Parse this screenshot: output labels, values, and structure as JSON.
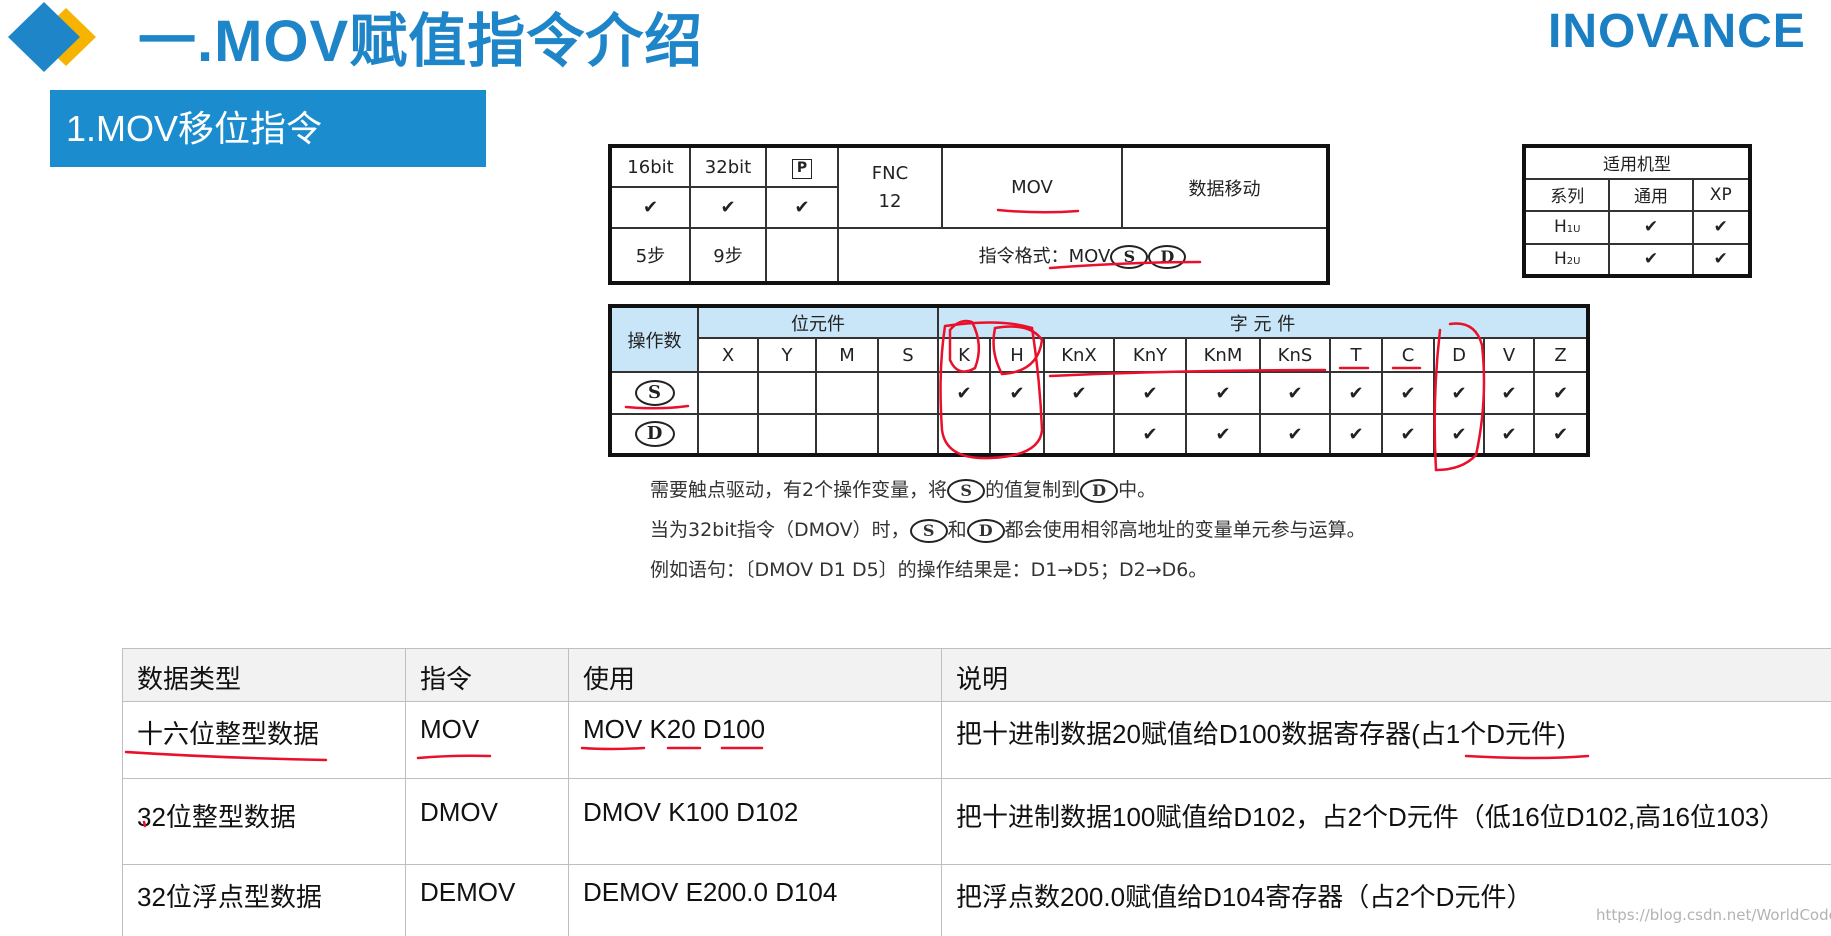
{
  "header": {
    "title": "一.MOV赋值指令介绍",
    "brand": "INOVANCE",
    "logo_icon": "diamond-logo-icon",
    "colors": {
      "brand_blue": "#1e86c8",
      "logo_gold": "#f6b400",
      "section_bg": "#1b8ccd"
    }
  },
  "section": {
    "title": "1.MOV移位指令"
  },
  "instruction_table": {
    "bit16": "16bit",
    "bit32": "32bit",
    "pulse_symbol": "P",
    "check": "✔",
    "fnc_label": "FNC",
    "fnc_no": "12",
    "mnemonic": "MOV",
    "description": "数据移动",
    "steps16": "5步",
    "steps32": "9步",
    "format_label": "指令格式：",
    "format_mnemonic": "MOV",
    "operand_s": "S",
    "operand_d": "D"
  },
  "models_table": {
    "title": "适用机型",
    "headers": [
      "系列",
      "通用",
      "XP"
    ],
    "rows": [
      {
        "name": "H",
        "sub": "1U",
        "general": "✔",
        "xp": "✔"
      },
      {
        "name": "H",
        "sub": "2U",
        "general": "✔",
        "xp": "✔"
      }
    ]
  },
  "operand_table": {
    "operand_label": "操作数",
    "bit_group": "位元件",
    "word_group": "字 元 件",
    "bit_devices": [
      "X",
      "Y",
      "M",
      "S"
    ],
    "word_devices": [
      "K",
      "H",
      "KnX",
      "KnY",
      "KnM",
      "KnS",
      "T",
      "C",
      "D",
      "V",
      "Z"
    ],
    "row_s": {
      "operand": "S",
      "word": [
        "✔",
        "✔",
        "✔",
        "✔",
        "✔",
        "✔",
        "✔",
        "✔",
        "✔",
        "✔",
        "✔"
      ]
    },
    "row_d": {
      "operand": "D",
      "word": [
        "",
        "",
        "",
        "✔",
        "✔",
        "✔",
        "✔",
        "✔",
        "✔",
        "✔",
        "✔"
      ]
    }
  },
  "notes": {
    "line1_a": "需要触点驱动，有2个操作变量，将",
    "line1_b": "的值复制到",
    "line1_c": "中。",
    "line2_a": "当为32bit指令（DMOV）时，",
    "line2_b": "和",
    "line2_c": "都会使用相邻高地址的变量单元参与运算。",
    "line3": "例如语句：〔DMOV  D1  D5〕的操作结果是：D1→D5；D2→D6。"
  },
  "data_table": {
    "headers": [
      "数据类型",
      "指令",
      "使用",
      "说明"
    ],
    "rows": [
      [
        "十六位整型数据",
        "MOV",
        "MOV K20 D100",
        "把十进制数据20赋值给D100数据寄存器(占1个D元件)"
      ],
      [
        "32位整型数据",
        "DMOV",
        "DMOV K100 D102",
        "把十进制数据100赋值给D102，占2个D元件（低16位D102,高16位103）"
      ],
      [
        "32位浮点型数据",
        "DEMOV",
        "DEMOV E200.0 D104",
        "把浮点数200.0赋值给D104寄存器（占2个D元件）"
      ]
    ]
  },
  "watermark": "https://blog.csdn.net/WorldCode",
  "annotation_color": "#e8102a"
}
